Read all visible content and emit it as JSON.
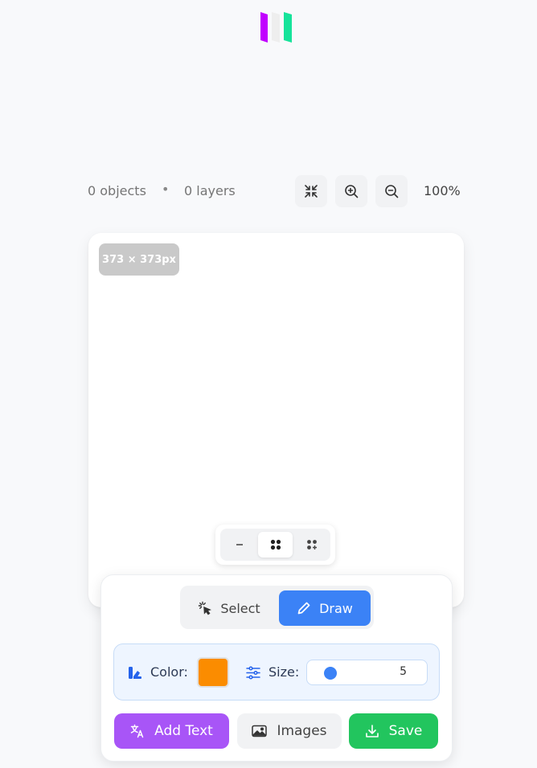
{
  "app": {
    "logo_icon": "app-logo",
    "logo_colors": [
      "#c100ff",
      "#f0f0f0",
      "#16e39a"
    ]
  },
  "info_bar": {
    "objects": "0 objects",
    "separator": "•",
    "layers": "0 layers",
    "fit_icon": "minimize-icon",
    "zoom_in_icon": "zoom-in-icon",
    "zoom_out_icon": "zoom-out-icon",
    "zoom_level": "100%"
  },
  "canvas": {
    "size_badge": "373 × 373px"
  },
  "brush_shapes": {
    "options": [
      "minus-icon",
      "dots-grid-icon",
      "dots-grid-plus-icon"
    ],
    "selected_index": 1
  },
  "toolbar": {
    "mode_select": "Select",
    "mode_draw": "Draw",
    "active_mode": "Draw",
    "color_label": "Color:",
    "color_value": "#fb8c00",
    "size_label": "Size:",
    "size_value": "5",
    "add_text": "Add Text",
    "images": "Images",
    "save": "Save"
  },
  "colors": {
    "accent_blue": "#3b82f6",
    "purple": "#a855f7",
    "green": "#22c55e"
  }
}
